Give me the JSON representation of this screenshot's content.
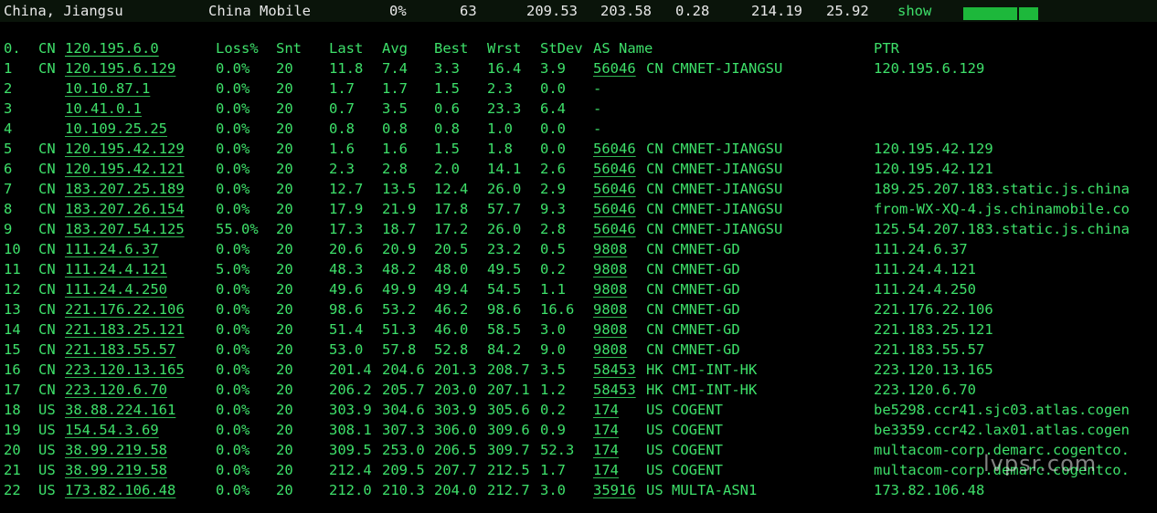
{
  "summary": {
    "location": "China, Jiangsu",
    "isp": "China Mobile",
    "loss": "0%",
    "snt": "63",
    "last": "209.53",
    "avg": "203.58",
    "best": "0.28",
    "wrst": "214.19",
    "stdev": "25.92",
    "show_label": "show",
    "bar_color": "#1db83b"
  },
  "header": {
    "num": "0.",
    "cc": "CN",
    "host": "120.195.6.0",
    "loss": "Loss%",
    "snt": "Snt",
    "last": "Last",
    "avg": "Avg",
    "best": "Best",
    "wrst": "Wrst",
    "stdev": "StDev",
    "asname": "AS Name",
    "ptr": "PTR"
  },
  "hops": [
    {
      "num": "1",
      "cc": "CN",
      "host": "120.195.6.129",
      "loss": "0.0%",
      "snt": "20",
      "last": "11.8",
      "avg": "7.4",
      "best": "3.3",
      "wrst": "16.4",
      "sd": "3.9",
      "asn": "56046",
      "ascc": "CN",
      "asname": "CMNET-JIANGSU",
      "ptr": "120.195.6.129"
    },
    {
      "num": "2",
      "cc": "",
      "host": "10.10.87.1",
      "loss": "0.0%",
      "snt": "20",
      "last": "1.7",
      "avg": "1.7",
      "best": "1.5",
      "wrst": "2.3",
      "sd": "0.0",
      "asn": "-",
      "ascc": "",
      "asname": "",
      "ptr": ""
    },
    {
      "num": "3",
      "cc": "",
      "host": "10.41.0.1",
      "loss": "0.0%",
      "snt": "20",
      "last": "0.7",
      "avg": "3.5",
      "best": "0.6",
      "wrst": "23.3",
      "sd": "6.4",
      "asn": "-",
      "ascc": "",
      "asname": "",
      "ptr": ""
    },
    {
      "num": "4",
      "cc": "",
      "host": "10.109.25.25",
      "loss": "0.0%",
      "snt": "20",
      "last": "0.8",
      "avg": "0.8",
      "best": "0.8",
      "wrst": "1.0",
      "sd": "0.0",
      "asn": "-",
      "ascc": "",
      "asname": "",
      "ptr": ""
    },
    {
      "num": "5",
      "cc": "CN",
      "host": "120.195.42.129",
      "loss": "0.0%",
      "snt": "20",
      "last": "1.6",
      "avg": "1.6",
      "best": "1.5",
      "wrst": "1.8",
      "sd": "0.0",
      "asn": "56046",
      "ascc": "CN",
      "asname": "CMNET-JIANGSU",
      "ptr": "120.195.42.129"
    },
    {
      "num": "6",
      "cc": "CN",
      "host": "120.195.42.121",
      "loss": "0.0%",
      "snt": "20",
      "last": "2.3",
      "avg": "2.8",
      "best": "2.0",
      "wrst": "14.1",
      "sd": "2.6",
      "asn": "56046",
      "ascc": "CN",
      "asname": "CMNET-JIANGSU",
      "ptr": "120.195.42.121"
    },
    {
      "num": "7",
      "cc": "CN",
      "host": "183.207.25.189",
      "loss": "0.0%",
      "snt": "20",
      "last": "12.7",
      "avg": "13.5",
      "best": "12.4",
      "wrst": "26.0",
      "sd": "2.9",
      "asn": "56046",
      "ascc": "CN",
      "asname": "CMNET-JIANGSU",
      "ptr": "189.25.207.183.static.js.china"
    },
    {
      "num": "8",
      "cc": "CN",
      "host": "183.207.26.154",
      "loss": "0.0%",
      "snt": "20",
      "last": "17.9",
      "avg": "21.9",
      "best": "17.8",
      "wrst": "57.7",
      "sd": "9.3",
      "asn": "56046",
      "ascc": "CN",
      "asname": "CMNET-JIANGSU",
      "ptr": "from-WX-XQ-4.js.chinamobile.co"
    },
    {
      "num": "9",
      "cc": "CN",
      "host": "183.207.54.125",
      "loss": "55.0%",
      "snt": "20",
      "last": "17.3",
      "avg": "18.7",
      "best": "17.2",
      "wrst": "26.0",
      "sd": "2.8",
      "asn": "56046",
      "ascc": "CN",
      "asname": "CMNET-JIANGSU",
      "ptr": "125.54.207.183.static.js.china"
    },
    {
      "num": "10",
      "cc": "CN",
      "host": "111.24.6.37",
      "loss": "0.0%",
      "snt": "20",
      "last": "20.6",
      "avg": "20.9",
      "best": "20.5",
      "wrst": "23.2",
      "sd": "0.5",
      "asn": "9808",
      "ascc": "CN",
      "asname": "CMNET-GD",
      "ptr": "111.24.6.37"
    },
    {
      "num": "11",
      "cc": "CN",
      "host": "111.24.4.121",
      "loss": "5.0%",
      "snt": "20",
      "last": "48.3",
      "avg": "48.2",
      "best": "48.0",
      "wrst": "49.5",
      "sd": "0.2",
      "asn": "9808",
      "ascc": "CN",
      "asname": "CMNET-GD",
      "ptr": "111.24.4.121"
    },
    {
      "num": "12",
      "cc": "CN",
      "host": "111.24.4.250",
      "loss": "0.0%",
      "snt": "20",
      "last": "49.6",
      "avg": "49.9",
      "best": "49.4",
      "wrst": "54.5",
      "sd": "1.1",
      "asn": "9808",
      "ascc": "CN",
      "asname": "CMNET-GD",
      "ptr": "111.24.4.250"
    },
    {
      "num": "13",
      "cc": "CN",
      "host": "221.176.22.106",
      "loss": "0.0%",
      "snt": "20",
      "last": "98.6",
      "avg": "53.2",
      "best": "46.2",
      "wrst": "98.6",
      "sd": "16.6",
      "asn": "9808",
      "ascc": "CN",
      "asname": "CMNET-GD",
      "ptr": "221.176.22.106"
    },
    {
      "num": "14",
      "cc": "CN",
      "host": "221.183.25.121",
      "loss": "0.0%",
      "snt": "20",
      "last": "51.4",
      "avg": "51.3",
      "best": "46.0",
      "wrst": "58.5",
      "sd": "3.0",
      "asn": "9808",
      "ascc": "CN",
      "asname": "CMNET-GD",
      "ptr": "221.183.25.121"
    },
    {
      "num": "15",
      "cc": "CN",
      "host": "221.183.55.57",
      "loss": "0.0%",
      "snt": "20",
      "last": "53.0",
      "avg": "57.8",
      "best": "52.8",
      "wrst": "84.2",
      "sd": "9.0",
      "asn": "9808",
      "ascc": "CN",
      "asname": "CMNET-GD",
      "ptr": "221.183.55.57"
    },
    {
      "num": "16",
      "cc": "CN",
      "host": "223.120.13.165",
      "loss": "0.0%",
      "snt": "20",
      "last": "201.4",
      "avg": "204.6",
      "best": "201.3",
      "wrst": "208.7",
      "sd": "3.5",
      "asn": "58453",
      "ascc": "HK",
      "asname": "CMI-INT-HK",
      "ptr": "223.120.13.165"
    },
    {
      "num": "17",
      "cc": "CN",
      "host": "223.120.6.70",
      "loss": "0.0%",
      "snt": "20",
      "last": "206.2",
      "avg": "205.7",
      "best": "203.0",
      "wrst": "207.1",
      "sd": "1.2",
      "asn": "58453",
      "ascc": "HK",
      "asname": "CMI-INT-HK",
      "ptr": "223.120.6.70"
    },
    {
      "num": "18",
      "cc": "US",
      "host": "38.88.224.161",
      "loss": "0.0%",
      "snt": "20",
      "last": "303.9",
      "avg": "304.6",
      "best": "303.9",
      "wrst": "305.6",
      "sd": "0.2",
      "asn": "174",
      "ascc": "US",
      "asname": "COGENT",
      "ptr": "be5298.ccr41.sjc03.atlas.cogen"
    },
    {
      "num": "19",
      "cc": "US",
      "host": "154.54.3.69",
      "loss": "0.0%",
      "snt": "20",
      "last": "308.1",
      "avg": "307.3",
      "best": "306.0",
      "wrst": "309.6",
      "sd": "0.9",
      "asn": "174",
      "ascc": "US",
      "asname": "COGENT",
      "ptr": "be3359.ccr42.lax01.atlas.cogen"
    },
    {
      "num": "20",
      "cc": "US",
      "host": "38.99.219.58",
      "loss": "0.0%",
      "snt": "20",
      "last": "309.5",
      "avg": "253.0",
      "best": "206.5",
      "wrst": "309.7",
      "sd": "52.3",
      "asn": "174",
      "ascc": "US",
      "asname": "COGENT",
      "ptr": "multacom-corp.demarc.cogentco."
    },
    {
      "num": "21",
      "cc": "US",
      "host": "38.99.219.58",
      "loss": "0.0%",
      "snt": "20",
      "last": "212.4",
      "avg": "209.5",
      "best": "207.7",
      "wrst": "212.5",
      "sd": "1.7",
      "asn": "174",
      "ascc": "US",
      "asname": "COGENT",
      "ptr": "multacom-corp.demarc.cogentco."
    },
    {
      "num": "22",
      "cc": "US",
      "host": "173.82.106.48",
      "loss": "0.0%",
      "snt": "20",
      "last": "212.0",
      "avg": "210.3",
      "best": "204.0",
      "wrst": "212.7",
      "sd": "3.0",
      "asn": "35916",
      "ascc": "US",
      "asname": "MULTA-ASN1",
      "ptr": "173.82.106.48"
    }
  ],
  "watermark": "lvpsr.com",
  "colors": {
    "background": "#000000",
    "text_green": "#3ee06a",
    "summary_text": "#e8e8e8"
  }
}
